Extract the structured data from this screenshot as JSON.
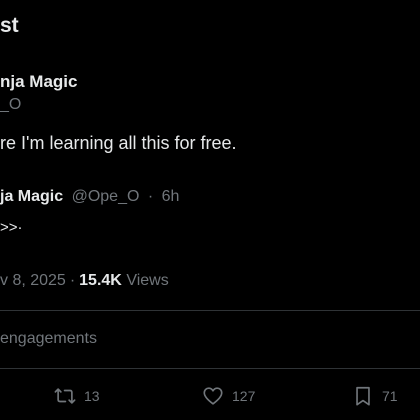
{
  "header": {
    "title": "st"
  },
  "post": {
    "author_name": "nja Magic",
    "author_handle": "_O",
    "text": "re I'm learning all this for free."
  },
  "quote": {
    "name": "ja Magic",
    "handle": "@Ope_O",
    "time_sep": "·",
    "time": "6h",
    "text": ">>·"
  },
  "meta": {
    "date": "v 8, 2025",
    "sep": "·",
    "views_count": "15.4K",
    "views_label": "Views"
  },
  "engagements_label": "engagements",
  "actions": {
    "retweets": "13",
    "likes": "127",
    "bookmarks": "71",
    "icons": [
      "retweet-icon",
      "heart-icon",
      "bookmark-icon"
    ]
  },
  "colors": {
    "background": "#000000",
    "text": "#e7e9ea",
    "muted": "#71767b",
    "divider": "#2f3336"
  }
}
